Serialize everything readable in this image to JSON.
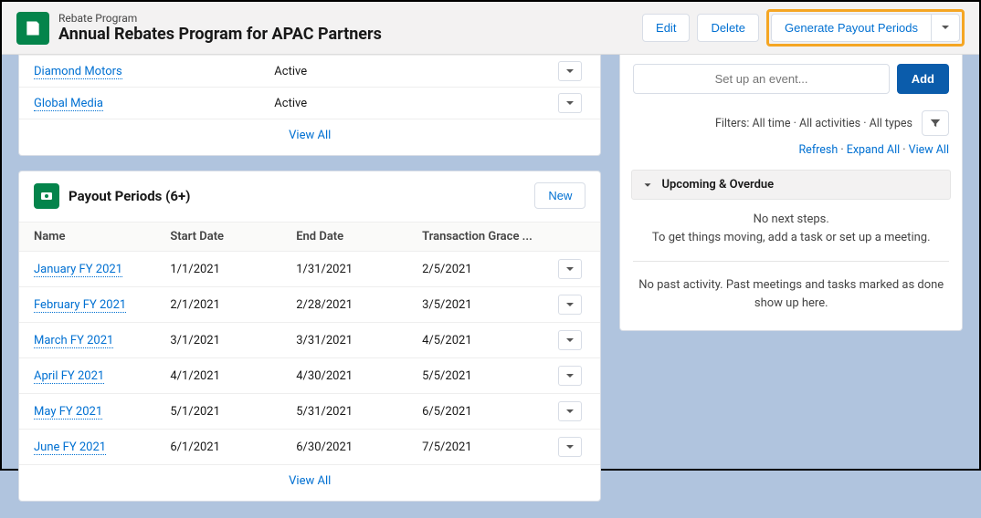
{
  "header": {
    "eyebrow": "Rebate Program",
    "title": "Annual Rebates Program for APAC Partners",
    "edit": "Edit",
    "delete": "Delete",
    "generate": "Generate Payout Periods"
  },
  "members": {
    "rows": [
      {
        "name": "Diamond Motors",
        "status": "Active"
      },
      {
        "name": "Global Media",
        "status": "Active"
      }
    ],
    "viewall": "View All"
  },
  "periods": {
    "title": "Payout Periods (6+)",
    "new": "New",
    "cols": {
      "name": "Name",
      "start": "Start Date",
      "end": "End Date",
      "grace": "Transaction Grace ..."
    },
    "rows": [
      {
        "name": "January FY 2021",
        "start": "1/1/2021",
        "end": "1/31/2021",
        "grace": "2/5/2021"
      },
      {
        "name": "February FY 2021",
        "start": "2/1/2021",
        "end": "2/28/2021",
        "grace": "3/5/2021"
      },
      {
        "name": "March FY 2021",
        "start": "3/1/2021",
        "end": "3/31/2021",
        "grace": "4/5/2021"
      },
      {
        "name": "April FY 2021",
        "start": "4/1/2021",
        "end": "4/30/2021",
        "grace": "5/5/2021"
      },
      {
        "name": "May FY 2021",
        "start": "5/1/2021",
        "end": "5/31/2021",
        "grace": "6/5/2021"
      },
      {
        "name": "June FY 2021",
        "start": "6/1/2021",
        "end": "6/30/2021",
        "grace": "7/5/2021"
      }
    ],
    "viewall": "View All"
  },
  "activity": {
    "event_placeholder": "Set up an event...",
    "add": "Add",
    "filters_label": "Filters: All time",
    "filters_activities": "All activities",
    "filters_types": "All types",
    "refresh": "Refresh",
    "expand": "Expand All",
    "viewall": "View All",
    "upcoming": "Upcoming & Overdue",
    "nosteps1": "No next steps.",
    "nosteps2": "To get things moving, add a task or set up a meeting.",
    "past": "No past activity. Past meetings and tasks marked as done show up here."
  }
}
